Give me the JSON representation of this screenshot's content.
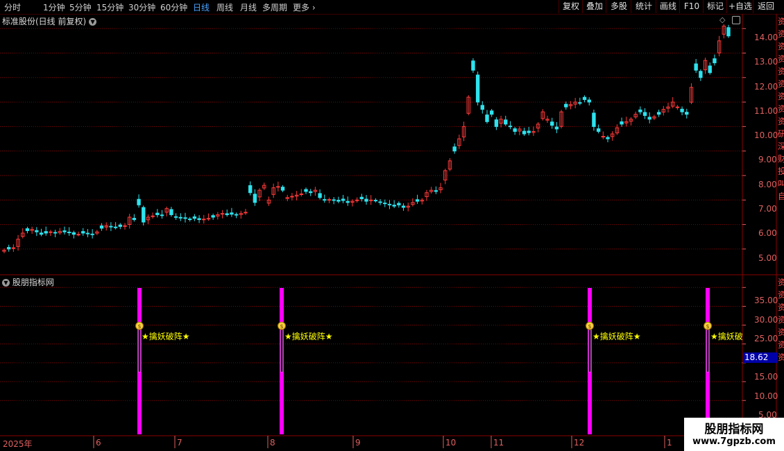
{
  "toolbar": {
    "timeframes": [
      "分时",
      "1分钟",
      "5分钟",
      "15分钟",
      "30分钟",
      "60分钟",
      "日线",
      "周线",
      "月线",
      "多周期",
      "更多"
    ],
    "active_timeframe": "日线",
    "right_buttons": [
      "复权",
      "叠加",
      "多股",
      "统计",
      "画线",
      "F10",
      "标记",
      "+自选",
      "返回"
    ]
  },
  "main_panel": {
    "title": "标准股份(日线 前复权)",
    "price_axis": [
      "14.00",
      "13.00",
      "12.00",
      "11.00",
      "10.00",
      "9.00",
      "8.00",
      "7.00",
      "6.00",
      "5.00"
    ]
  },
  "indicator_panel": {
    "title": "股朋指标网",
    "axis": [
      "35.00",
      "30.00",
      "25.00",
      "20.00",
      "15.00",
      "10.00",
      "5.00"
    ],
    "current_value": "18.62",
    "signal_label": "★擒妖破阵★",
    "signal_label_cut": "★擒妖破",
    "signal_dates": [
      "2025-06-20",
      "2025-08-06",
      "2025-12-04",
      "2026-01-14"
    ]
  },
  "x_axis": [
    "2025年",
    "6",
    "7",
    "8",
    "9",
    "10",
    "11",
    "12",
    "1"
  ],
  "side_cells": [
    "资",
    "资",
    "资",
    "资",
    "资",
    "资",
    "资",
    "资",
    "资",
    "研",
    "深",
    "财",
    "投",
    "叫",
    "自",
    "资",
    "资",
    "资",
    "资",
    "资",
    "资",
    "资"
  ],
  "watermark": {
    "name": "股朋指标网",
    "url": "www.7gpzb.com"
  },
  "colors": {
    "up": "#ff3a3a",
    "down": "#2de3ee",
    "signal_bar": "#ff00ff",
    "grid": "#8b0000",
    "axis": "#e06060"
  },
  "chart_data": {
    "type": "candlestick",
    "title": "标准股份(日线 前复权)",
    "price_range": [
      4.5,
      14.6
    ],
    "price_ticks": [
      5,
      6,
      7,
      8,
      9,
      10,
      11,
      12,
      13,
      14
    ],
    "months": [
      "2025-05",
      "2025-06",
      "2025-07",
      "2025-08",
      "2025-09",
      "2025-10",
      "2025-11",
      "2025-12",
      "2026-01"
    ],
    "close": [
      4.95,
      5.0,
      5.05,
      5.4,
      5.65,
      5.75,
      5.8,
      5.7,
      5.6,
      5.65,
      5.7,
      5.65,
      5.72,
      5.7,
      5.68,
      5.6,
      5.6,
      5.65,
      5.62,
      5.6,
      5.7,
      5.85,
      5.95,
      5.9,
      5.88,
      5.92,
      5.95,
      6.3,
      6.2,
      6.8,
      6.1,
      6.3,
      6.35,
      6.4,
      6.38,
      6.65,
      6.4,
      6.3,
      6.28,
      6.25,
      6.2,
      6.25,
      6.2,
      6.22,
      6.25,
      6.3,
      6.4,
      6.45,
      6.4,
      6.42,
      6.4,
      6.45,
      6.5,
      7.3,
      6.9,
      7.4,
      7.6,
      7.0,
      7.5,
      7.55,
      7.4,
      7.1,
      7.15,
      7.2,
      7.25,
      7.35,
      7.3,
      7.4,
      7.1,
      7.0,
      7.02,
      7.0,
      6.95,
      6.98,
      6.9,
      6.95,
      7.0,
      7.05,
      6.95,
      7.0,
      6.98,
      6.9,
      6.85,
      6.8,
      6.75,
      6.8,
      6.7,
      6.75,
      6.9,
      6.95,
      7.0,
      7.3,
      7.4,
      7.35,
      7.5,
      8.2,
      8.6,
      9.0,
      9.5,
      10.0,
      11.2,
      12.3,
      11.0,
      10.7,
      10.2,
      10.5,
      10.0,
      10.3,
      10.1,
      10.0,
      9.8,
      9.9,
      9.7,
      9.75,
      9.8,
      10.1,
      10.6,
      10.3,
      10.05,
      9.9,
      10.6,
      10.8,
      10.9,
      11.0,
      10.95,
      11.1,
      11.0,
      10.0,
      9.8,
      9.6,
      9.5,
      9.7,
      9.95,
      10.1,
      10.2,
      10.3,
      10.5,
      10.6,
      10.45,
      10.3,
      10.4,
      10.5,
      10.7,
      10.8,
      11.0,
      10.8,
      10.6,
      10.5,
      11.6,
      12.3,
      12.0,
      12.7,
      12.2,
      12.6,
      13.5,
      14.1,
      13.7
    ],
    "signals_value": [
      25,
      25,
      25,
      25
    ],
    "indicator_range": [
      3.5,
      38
    ],
    "indicator_ticks": [
      5,
      10,
      15,
      20,
      25,
      30,
      35
    ],
    "indicator_current": 18.62
  }
}
